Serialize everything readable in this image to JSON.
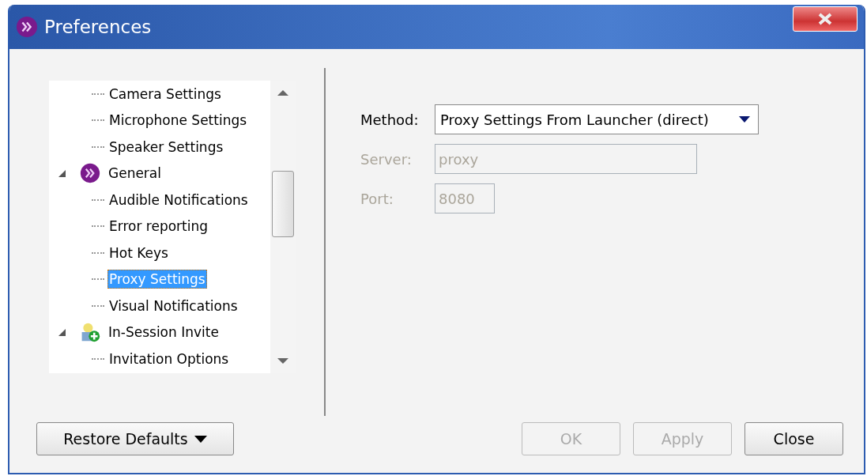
{
  "window": {
    "title": "Preferences"
  },
  "tree": [
    {
      "label": "Camera Settings",
      "selected": false
    },
    {
      "label": "Microphone Settings",
      "selected": false
    },
    {
      "label": "Speaker Settings",
      "selected": false
    },
    {
      "label": "General",
      "selected": false,
      "expanded": true,
      "kind": "brand",
      "children": [
        {
          "label": "Audible Notifications",
          "selected": false
        },
        {
          "label": "Error reporting",
          "selected": false
        },
        {
          "label": "Hot Keys",
          "selected": false
        },
        {
          "label": "Proxy Settings",
          "selected": true
        },
        {
          "label": "Visual Notifications",
          "selected": false
        }
      ]
    },
    {
      "label": "In-Session Invite",
      "selected": false,
      "expanded": true,
      "kind": "invite",
      "children": [
        {
          "label": "Invitation Options",
          "selected": false
        }
      ]
    }
  ],
  "form": {
    "method": {
      "label": "Method:",
      "value": "Proxy Settings From Launcher (direct)"
    },
    "server": {
      "label": "Server:",
      "value": "proxy",
      "disabled": true
    },
    "port": {
      "label": "Port:",
      "value": "8080",
      "disabled": true
    }
  },
  "buttons": [
    {
      "label": "Restore Defaults",
      "kind": "menu",
      "disabled": false
    },
    {
      "label": "OK",
      "kind": "plain",
      "disabled": true
    },
    {
      "label": "Apply",
      "kind": "plain",
      "disabled": true
    },
    {
      "label": "Close",
      "kind": "plain",
      "disabled": false
    }
  ]
}
